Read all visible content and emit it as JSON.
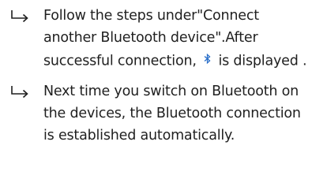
{
  "steps": [
    {
      "bullet_icon": "right-hook-arrow",
      "text_before": "Follow the steps under\"Connect another Bluetooth device\".After successful connection, ",
      "inline_icon": "bluetooth-icon",
      "text_after": " is displayed ."
    },
    {
      "bullet_icon": "right-hook-arrow",
      "text": "Next time you switch on Bluetooth on the devices, the Bluetooth connection is established automatically."
    }
  ],
  "colors": {
    "text": "#1f1f1f",
    "bluetooth_icon": "#2a6fc9"
  }
}
